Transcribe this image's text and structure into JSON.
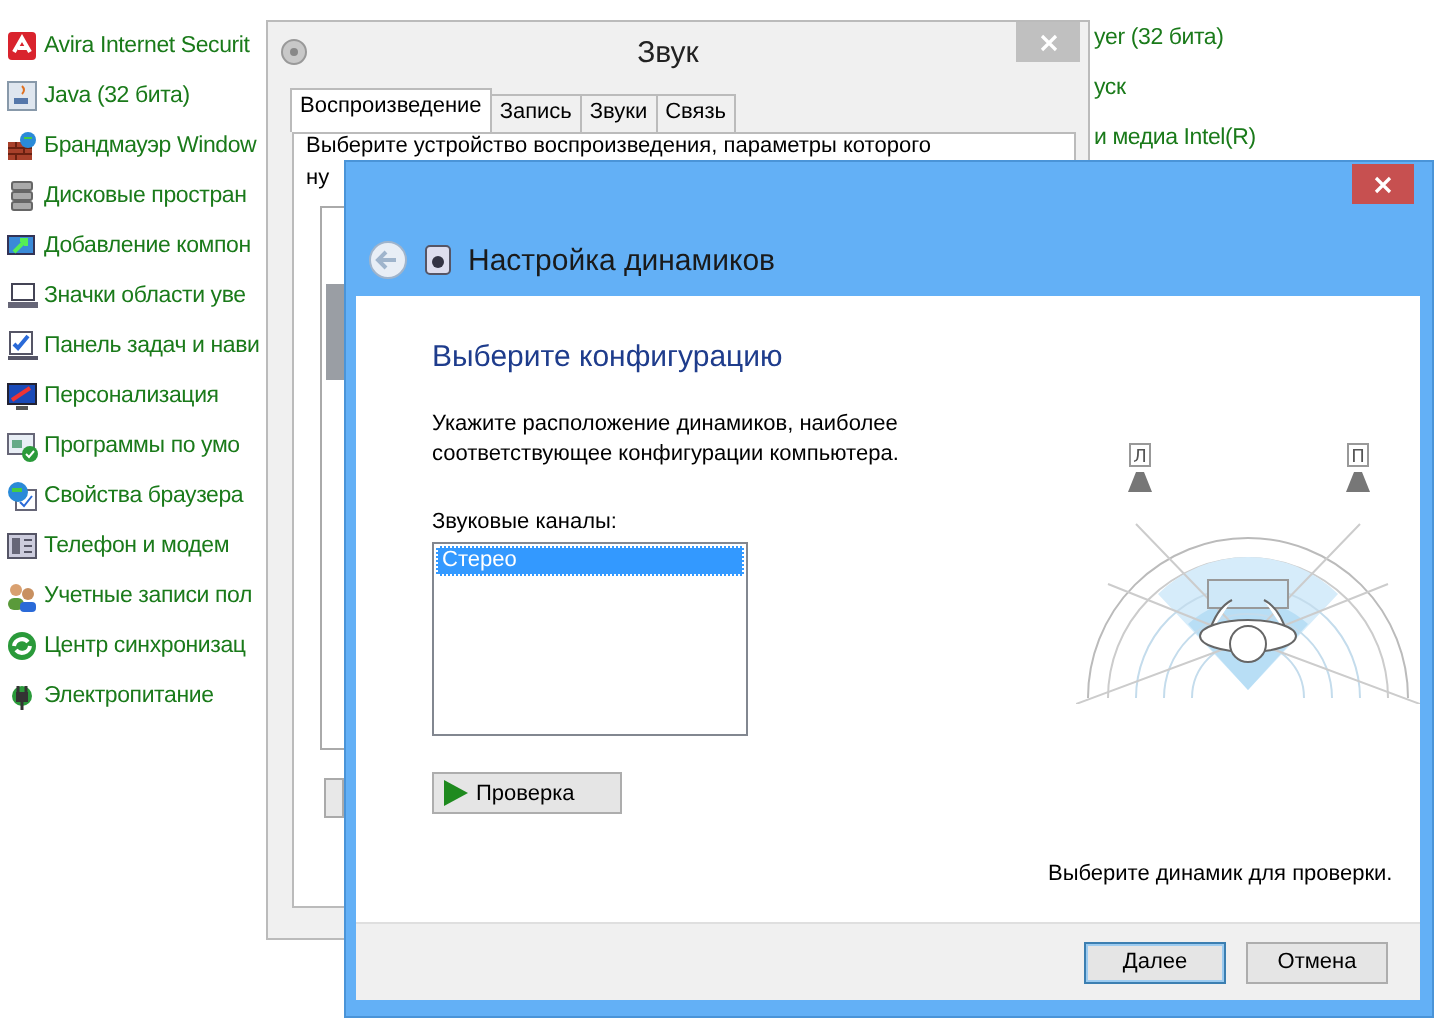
{
  "control_panel": {
    "items": [
      {
        "label": "Avira Internet Securit"
      },
      {
        "label": "Java (32 бита)"
      },
      {
        "label": "Брандмауэр Window"
      },
      {
        "label": "Дисковые простран"
      },
      {
        "label": "Добавление компон"
      },
      {
        "label": "Значки области уве"
      },
      {
        "label": "Панель задач и нави"
      },
      {
        "label": "Персонализация"
      },
      {
        "label": "Программы по умо"
      },
      {
        "label": "Свойства браузера"
      },
      {
        "label": "Телефон и модем"
      },
      {
        "label": "Учетные записи пол"
      },
      {
        "label": "Центр синхронизац"
      },
      {
        "label": "Электропитание"
      }
    ],
    "column_2": [
      {
        "label": "yer (32 бита)"
      },
      {
        "label": "уск"
      },
      {
        "label": "и медиа Intel(R)"
      }
    ]
  },
  "sound_window": {
    "title": "Звук",
    "tabs": [
      {
        "label": "Воспроизведение",
        "selected": true
      },
      {
        "label": "Запись",
        "selected": false
      },
      {
        "label": "Звуки",
        "selected": false
      },
      {
        "label": "Связь",
        "selected": false
      }
    ],
    "instruction": [
      "Выберите устройство воспроизведения, параметры которого",
      "ну"
    ]
  },
  "speaker_setup": {
    "title": "Настройка динамиков",
    "heading": "Выберите конфигурацию",
    "description": "Укажите расположение динамиков, наиболее соответствующее конфигурации компьютера.",
    "channels_label": "Звуковые каналы:",
    "channels": [
      {
        "label": "Стерео",
        "selected": true
      }
    ],
    "test_button": "Проверка",
    "speakers": [
      {
        "label": "Л"
      },
      {
        "label": "П"
      }
    ],
    "hint": "Выберите динамик для проверки.",
    "buttons": [
      {
        "label": "Далее",
        "default": true
      },
      {
        "label": "Отмена",
        "default": false
      }
    ]
  }
}
